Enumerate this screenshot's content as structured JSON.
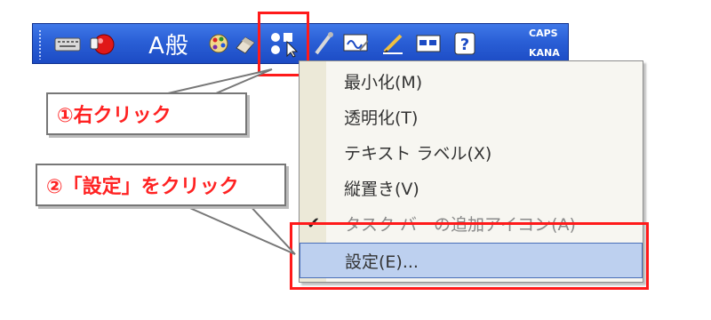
{
  "langbar": {
    "mode_text": "A般",
    "caps_label": "CAPS",
    "kana_label": "KANA"
  },
  "menu": {
    "items": [
      {
        "label": "最小化(M)",
        "checked": false,
        "disabled": false,
        "selected": false
      },
      {
        "label": "透明化(T)",
        "checked": false,
        "disabled": false,
        "selected": false
      },
      {
        "label": "テキスト ラベル(X)",
        "checked": false,
        "disabled": false,
        "selected": false
      },
      {
        "label": "縦置き(V)",
        "checked": false,
        "disabled": false,
        "selected": false
      },
      {
        "label": "タスク バーの追加アイコン(A)",
        "checked": true,
        "disabled": true,
        "selected": false
      },
      {
        "label": "設定(E)...",
        "checked": false,
        "disabled": false,
        "selected": true
      }
    ]
  },
  "callouts": {
    "step1": "①右クリック",
    "step2": "②「設定」をクリック"
  },
  "colors": {
    "highlight": "#ff1a1a",
    "callout_text": "#ff2222",
    "langbar_blue": "#2a5fd6",
    "menu_selected": "#bdd0ef"
  }
}
